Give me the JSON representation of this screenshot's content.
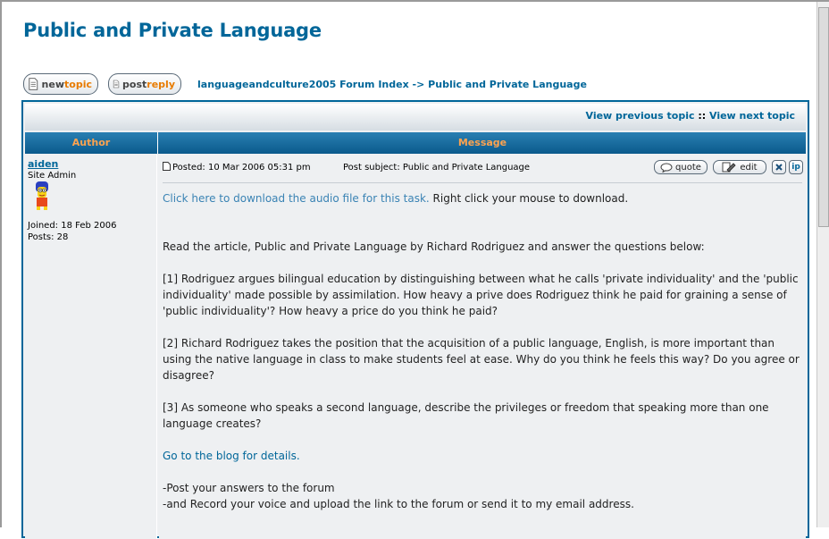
{
  "page_title": "Public and Private Language",
  "toolbar": {
    "newtopic": {
      "w1": "new",
      "w2": "topic"
    },
    "postreply": {
      "w1": "post",
      "w2": "reply"
    }
  },
  "breadcrumb": {
    "forum_index": "languageandculture2005 Forum Index",
    "arrow": "->",
    "current": "Public and Private Language"
  },
  "topic_nav": {
    "previous": "View previous topic",
    "separator": "::",
    "next": "View next topic"
  },
  "columns": {
    "author": "Author",
    "message": "Message"
  },
  "post": {
    "author": {
      "name": "aiden",
      "rank": "Site Admin",
      "joined": "Joined: 18 Feb 2006",
      "posts": "Posts: 28"
    },
    "posted": "Posted: 10 Mar 2006 05:31 pm",
    "subject": "Post subject: Public and Private Language",
    "actions": {
      "quote": "quote",
      "edit": "edit",
      "ip": "ip"
    },
    "body": {
      "audio_link": "Click here to download the audio file for this task.",
      "audio_hint": " Right click your mouse to download.",
      "intro": "Read the article, Public and Private Language by Richard Rodriguez and answer the questions below:",
      "q1": "[1] Rodriguez argues bilingual education by distinguishing between what he calls 'private individuality' and the 'public individuality' made possible by assimilation. How heavy a prive does Rodriguez think he paid for graining a sense of 'public individuality'? How heavy a price do you think he paid?",
      "q2": "[2] Richard Rodriguez takes the position that the acquisition of a public language, English, is more important than using the native language in class to make students feel at ease. Why do you think he feels this way? Do you agree or disagree?",
      "q3": "[3] As someone who speaks a second language, describe the privileges or freedom that speaking more than one language creates?",
      "blog_link": "Go to the blog for details.",
      "instr1": "-Post your answers to the forum",
      "instr2": "-and Record your voice and upload the link to the forum or send it to my email address."
    }
  },
  "colors": {
    "brand_blue": "#006699",
    "header_orange": "#ffa34f",
    "button_orange": "#e87b00",
    "panel_bg": "#eef0f2"
  }
}
